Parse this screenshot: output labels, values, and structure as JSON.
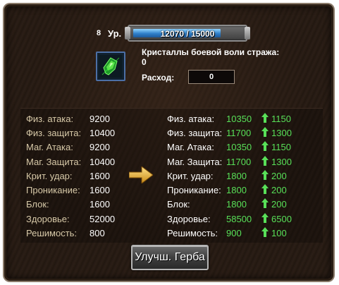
{
  "level": {
    "number": "8",
    "label": "Ур."
  },
  "xp": {
    "text": "12070 / 15000",
    "fraction": 0.805
  },
  "item": {
    "icon": "green-crystal-icon",
    "name": "Кристаллы боевой воли стража: 0",
    "cost_label": "Расход:",
    "cost_value": "0"
  },
  "stats_current": [
    {
      "name": "Физ. атака:",
      "value": "9200"
    },
    {
      "name": "Физ. защита:",
      "value": "10400"
    },
    {
      "name": "Маг. Атака:",
      "value": "9200"
    },
    {
      "name": "Маг. Защита:",
      "value": "10400"
    },
    {
      "name": "Крит. удар:",
      "value": "1600"
    },
    {
      "name": "Проникание:",
      "value": "1600"
    },
    {
      "name": "Блок:",
      "value": "1600"
    },
    {
      "name": "Здоровье:",
      "value": "52000"
    },
    {
      "name": "Решимость:",
      "value": "800"
    }
  ],
  "stats_next": [
    {
      "name": "Физ. атака:",
      "value": "10350",
      "increase": "1150"
    },
    {
      "name": "Физ. защита:",
      "value": "11700",
      "increase": "1300"
    },
    {
      "name": "Маг. Атака:",
      "value": "10350",
      "increase": "1150"
    },
    {
      "name": "Маг. Защита:",
      "value": "11700",
      "increase": "1300"
    },
    {
      "name": "Крит. удар:",
      "value": "1800",
      "increase": "200"
    },
    {
      "name": "Проникание:",
      "value": "1800",
      "increase": "200"
    },
    {
      "name": "Блок:",
      "value": "1800",
      "increase": "200"
    },
    {
      "name": "Здоровье:",
      "value": "58500",
      "increase": "6500"
    },
    {
      "name": "Решимость:",
      "value": "900",
      "increase": "100"
    }
  ],
  "upgrade_button": "Улучш. Герба",
  "colors": {
    "increase_green": "#58e058",
    "stat_label": "#d7c9a8",
    "xp_blue": "#2f7fc9"
  }
}
